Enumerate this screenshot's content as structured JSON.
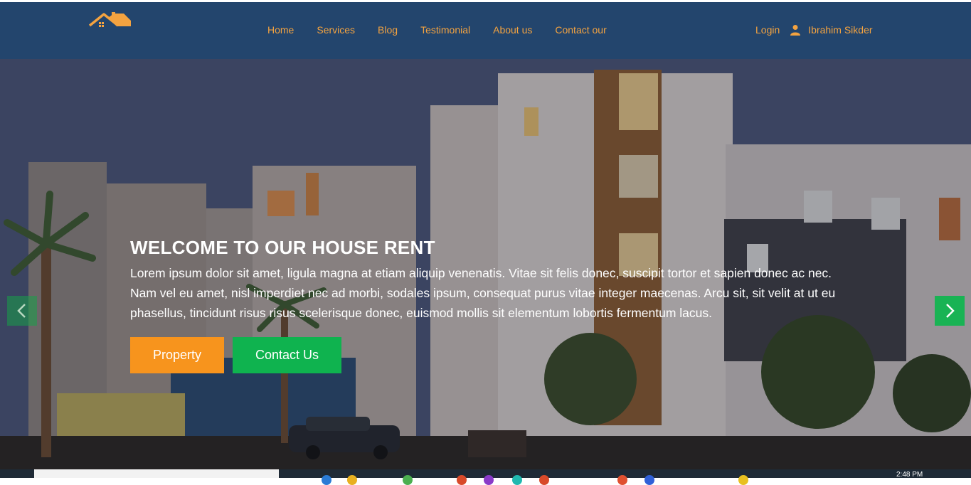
{
  "nav": {
    "links": [
      "Home",
      "Services",
      "Blog",
      "Testimonial",
      "About us",
      "Contact our"
    ],
    "login": "Login",
    "user_name": "Ibrahim Sikder"
  },
  "hero": {
    "title": "WELCOME TO OUR HOUSE RENT",
    "text": "Lorem ipsum dolor sit amet, ligula magna at etiam aliquip venenatis. Vitae sit felis donec, suscipit tortor et sapien donec ac nec. Nam vel eu amet, nisl imperdiet nec ad morbi, sodales ipsum, consequat purus vitae integer maecenas. Arcu sit, sit velit at ut eu phasellus, tincidunt risus risus scelerisque donec, euismod mollis sit elementum lobortis fermentum lacus.",
    "property_button": "Property",
    "contact_button": "Contact Us"
  },
  "taskbar": {
    "clock": "2:48 PM"
  },
  "colors": {
    "navbar_bg": "#23456d",
    "nav_text": "#f4a340",
    "property_btn": "#f7941d",
    "contact_btn": "#0fb34f",
    "arrow_btn": "#19b354"
  },
  "icons": [
    "house-logo-icon",
    "user-icon",
    "chevron-left-icon",
    "chevron-right-icon"
  ]
}
